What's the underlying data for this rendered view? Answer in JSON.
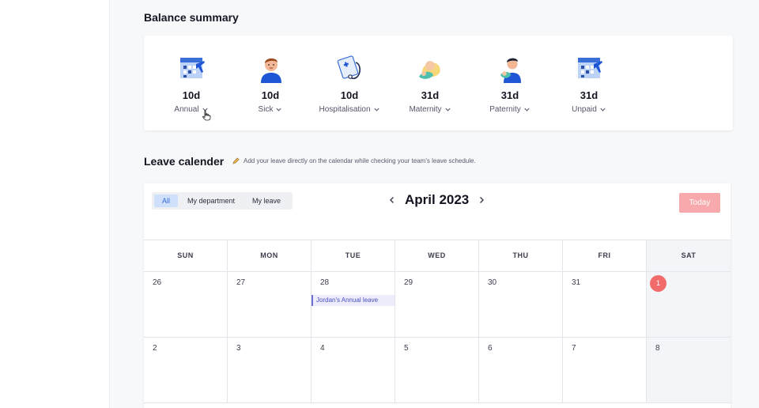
{
  "balance": {
    "title": "Balance summary",
    "items": [
      {
        "days": "10d",
        "type": "Annual",
        "icon": "calendar-plane-icon"
      },
      {
        "days": "10d",
        "type": "Sick",
        "icon": "sick-person-icon"
      },
      {
        "days": "10d",
        "type": "Hospitalisation",
        "icon": "medical-clipboard-icon"
      },
      {
        "days": "31d",
        "type": "Maternity",
        "icon": "mother-baby-icon"
      },
      {
        "days": "31d",
        "type": "Paternity",
        "icon": "father-baby-icon"
      },
      {
        "days": "31d",
        "type": "Unpaid",
        "icon": "calendar-plane-icon"
      }
    ]
  },
  "calendar": {
    "title": "Leave calender",
    "hint": "Add your leave directly on the calendar while checking your team's leave schedule.",
    "filters": [
      "All",
      "My department",
      "My leave"
    ],
    "active_filter": "All",
    "month": "April 2023",
    "today_label": "Today",
    "days_of_week": [
      "SUN",
      "MON",
      "TUE",
      "WED",
      "THU",
      "FRI",
      "SAT"
    ],
    "weeks": [
      [
        "26",
        "27",
        "28",
        "29",
        "30",
        "31",
        "1"
      ],
      [
        "2",
        "3",
        "4",
        "5",
        "6",
        "7",
        "8"
      ]
    ],
    "today": "1",
    "events": [
      {
        "label": "Jordan's Annual leave",
        "week": 0,
        "day": 2
      }
    ]
  },
  "colors": {
    "accent_blue": "#3567d6",
    "today_red": "#f26b6b",
    "today_button": "#f7a9ab",
    "event_purple": "#6b6fd6"
  }
}
